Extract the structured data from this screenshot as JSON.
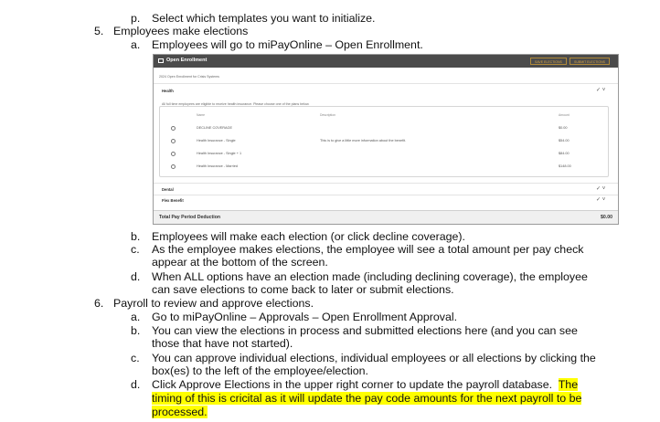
{
  "doc": {
    "p_marker": "p.",
    "p_text": "Select which templates you want to initialize.",
    "s5_marker": "5.",
    "s5_text": "Employees make elections",
    "s5a_marker": "a.",
    "s5a_text": "Employees will go to miPayOnline – Open Enrollment.",
    "s5b_marker": "b.",
    "s5b_text": "Employees will make each election (or click decline coverage).",
    "s5c_marker": "c.",
    "s5c_line1": "As the employee makes elections, the employee will see a total amount per pay check",
    "s5c_line2": "appear at the bottom of the screen.",
    "s5d_marker": "d.",
    "s5d_line1": "When ALL options have an election made (including declining coverage), the employee",
    "s5d_line2": "can save elections to come back to later or submit elections.",
    "s6_marker": "6.",
    "s6_text": "Payroll to review and approve elections.",
    "s6a_marker": "a.",
    "s6a_text": "Go to miPayOnline – Approvals – Open Enrollment Approval.",
    "s6b_marker": "b.",
    "s6b_line1": "You can view the elections in process and submitted elections here (and you can see",
    "s6b_line2": "those that have not started).",
    "s6c_marker": "c.",
    "s6c_line1": "You can approve individual elections, individual employees or all elections by clicking the",
    "s6c_line2": "box(es) to the left of the employee/election.",
    "s6d_marker": "d.",
    "s6d_line1_plain": "Click Approve Elections in the upper right corner to update the payroll database.  ",
    "s6d_line1_hl": "The",
    "s6d_line2": "timing of this is cricital as it will update the pay code amounts for the next payroll to be",
    "s6d_line3": "processed."
  },
  "shot": {
    "title": "Open Enrollment",
    "btn_save": "SAVE ELECTIONS",
    "btn_submit": "SUBMIT ELECTIONS",
    "subtitle": "2024 Open Enrollment for Crisis Systems",
    "health_label": "Health",
    "health_note": "All full time employees are eligible to receive health insurance. Please choose one of the plans below.",
    "col_name": "Name",
    "col_desc": "Description",
    "col_amount": "Amount",
    "plans": [
      {
        "name": "DECLINE COVERAGE",
        "desc": "",
        "amount": "$0.00"
      },
      {
        "name": "Health Insurance - Single",
        "desc": "This is to give a little more information about the benefit.",
        "amount": "$54.00"
      },
      {
        "name": "Health Insurance - Single + 1",
        "desc": "",
        "amount": "$84.00"
      },
      {
        "name": "Health Insurance - Married",
        "desc": "",
        "amount": "$148.00"
      }
    ],
    "dental_label": "Dental",
    "flex_label": "Flex Benefit",
    "total_label": "Total Pay Period Deduction",
    "total_amount": "$0.00",
    "check_glyph": "✓ ˅"
  }
}
